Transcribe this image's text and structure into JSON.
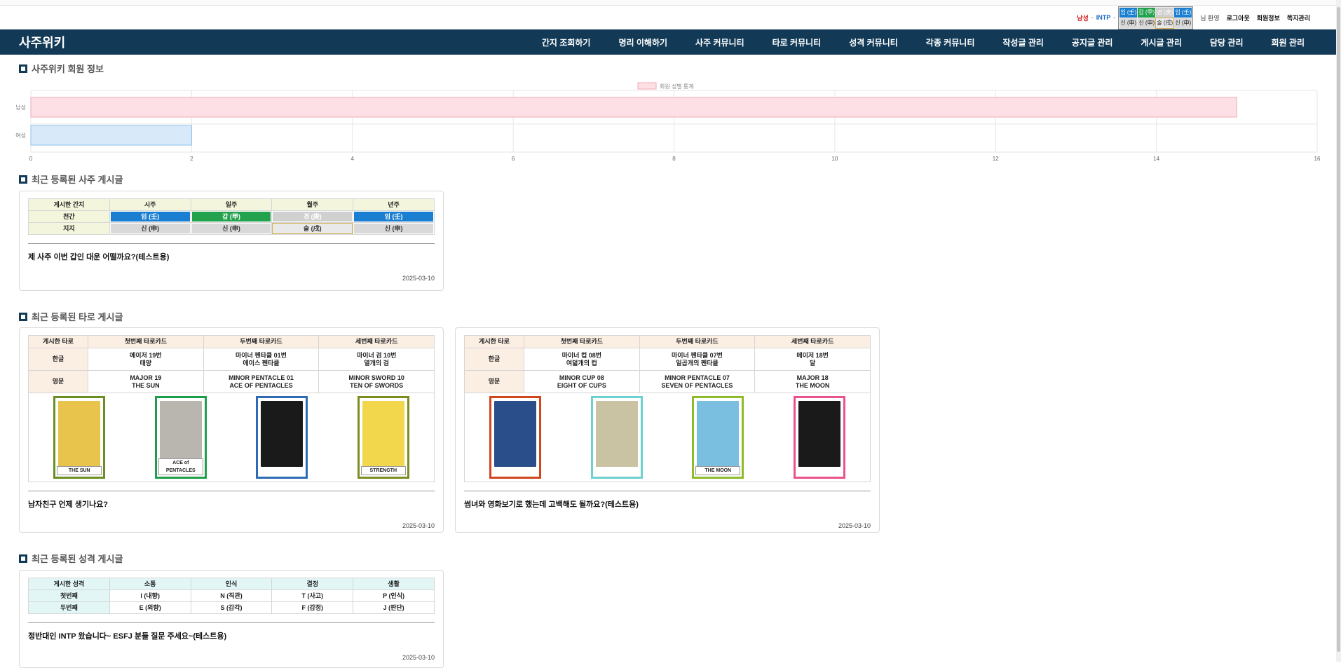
{
  "userbar": {
    "gender": "남성",
    "mbti": "INTP",
    "sep": "-",
    "mini_saju": [
      "임 (壬)",
      "갑 (甲)",
      "경 (庚)",
      "임 (壬)",
      "신 (申)",
      "신 (申)",
      "술 (戌)",
      "신 (申)"
    ],
    "greeting": "님 환영",
    "logout": "로그아웃",
    "profile": "회원정보",
    "messages": "쪽지관리"
  },
  "brand": "사주위키",
  "nav": [
    "간지 조회하기",
    "명리 이해하기",
    "사주 커뮤니티",
    "타로 커뮤니티",
    "성격 커뮤니티",
    "각종 커뮤니티",
    "작성글 관리",
    "공지글 관리",
    "게시글 관리",
    "담당 관리",
    "회원 관리"
  ],
  "sections": {
    "members": "사주위키 회원 정보",
    "saju": "최근 등록된 사주 게시글",
    "tarot": "최근 등록된 타로 게시글",
    "mbti": "최근 등록된 성격 게시글"
  },
  "chart_data": {
    "type": "bar",
    "orientation": "horizontal",
    "categories": [
      "남성",
      "여성"
    ],
    "series": [
      {
        "name": "회원 성별 통계",
        "values": [
          15,
          2
        ]
      }
    ],
    "xlim": [
      0,
      16
    ],
    "xticks": [
      0,
      2,
      4,
      6,
      8,
      10,
      12,
      14,
      16
    ],
    "colors": {
      "남성": "#fde0e5",
      "여성": "#d8eaf9"
    },
    "borders": {
      "남성": "#f3a7b5",
      "여성": "#8fc1ea"
    },
    "legend_position": "top-center",
    "grid": true
  },
  "saju_post": {
    "headers": [
      "게시한 간지",
      "시주",
      "일주",
      "월주",
      "년주"
    ],
    "rows": [
      {
        "label": "천간",
        "cells": [
          "임 (壬)",
          "갑 (甲)",
          "경 (庚)",
          "임 (壬)"
        ]
      },
      {
        "label": "지지",
        "cells": [
          "신 (申)",
          "신 (申)",
          "술 (戌)",
          "신 (申)"
        ]
      }
    ],
    "title": "제 사주 이번 갑인 대운 어떨까요?(테스트용)",
    "date": "2025-03-10"
  },
  "tarot_posts": [
    {
      "headers": [
        "게시한 타로",
        "첫번째 타로카드",
        "두번째 타로카드",
        "세번째 타로카드"
      ],
      "row_ko": "한글",
      "row_en": "영문",
      "cards": [
        {
          "ko1": "메이저 19번",
          "ko2": "태양",
          "en1": "MAJOR 19",
          "en2": "THE SUN",
          "cap": "THE SUN",
          "frame": "#6b8e23",
          "art": "#e8c44c"
        },
        {
          "ko1": "마이너 펜타클 01번",
          "ko2": "에이스 펜타클",
          "en1": "MINOR PENTACLE 01",
          "en2": "ACE OF PENTACLES",
          "cap": "ACE of PENTACLES",
          "frame": "#1e9e4a",
          "art": "#b9b6b0"
        },
        {
          "ko1": "마이너 검 10번",
          "ko2": "열개의 검",
          "en1": "MINOR SWORD 10",
          "en2": "TEN OF SWORDS",
          "cap": "",
          "frame": "#2d6cb5",
          "art": "#1a1a1a"
        },
        {
          "ko1": "마이너 검 10번",
          "ko2": "열개의 검",
          "en1": "MINOR SWORD 10",
          "en2": "TEN OF SWORDS",
          "cap": "STRENGTH",
          "frame": "#7b8d1e",
          "art": "#f2d74c"
        }
      ],
      "title": "남자친구 언제 생기나요?",
      "date": "2025-03-10"
    },
    {
      "headers": [
        "게시한 타로",
        "첫번째 타로카드",
        "두번째 타로카드",
        "세번째 타로카드"
      ],
      "row_ko": "한글",
      "row_en": "영문",
      "cards": [
        {
          "ko1": "마이너 컵 08번",
          "ko2": "여덟개의 컵",
          "en1": "MINOR CUP 08",
          "en2": "EIGHT OF CUPS",
          "cap": "",
          "frame": "#d2461e",
          "art": "#2a4e8a"
        },
        {
          "ko1": "마이너 펜타클 07번",
          "ko2": "일곱개의 펜타클",
          "en1": "MINOR PENTACLE 07",
          "en2": "SEVEN OF PENTACLES",
          "cap": "",
          "frame": "#6fd0d0",
          "art": "#c9c3a3"
        },
        {
          "ko1": "메이저 18번",
          "ko2": "달",
          "en1": "MAJOR 18",
          "en2": "THE MOON",
          "cap": "THE MOON",
          "frame": "#8dbb2a",
          "art": "#7bbfe0"
        },
        {
          "ko1": "메이저 18번",
          "ko2": "달",
          "en1": "MAJOR 18",
          "en2": "THE MOON",
          "cap": "",
          "frame": "#e9528d",
          "art": "#1a1a1a"
        }
      ],
      "title": "썸녀와 영화보기로 했는데 고백해도 될까요?(테스트용)",
      "date": "2025-03-10"
    }
  ],
  "mbti_post": {
    "headers": [
      "게시한 성격",
      "소통",
      "인식",
      "결정",
      "생활"
    ],
    "rows": [
      {
        "label": "첫번째",
        "cells": [
          "I (내향)",
          "N (직관)",
          "T (사고)",
          "P (인식)"
        ]
      },
      {
        "label": "두번째",
        "cells": [
          "E (외향)",
          "S (감각)",
          "F (감정)",
          "J (판단)"
        ]
      }
    ],
    "title": "정반대인 INTP 왔습니다~ ESFJ 분들 질문 주세요~(테스트용)",
    "date": "2025-03-10"
  }
}
